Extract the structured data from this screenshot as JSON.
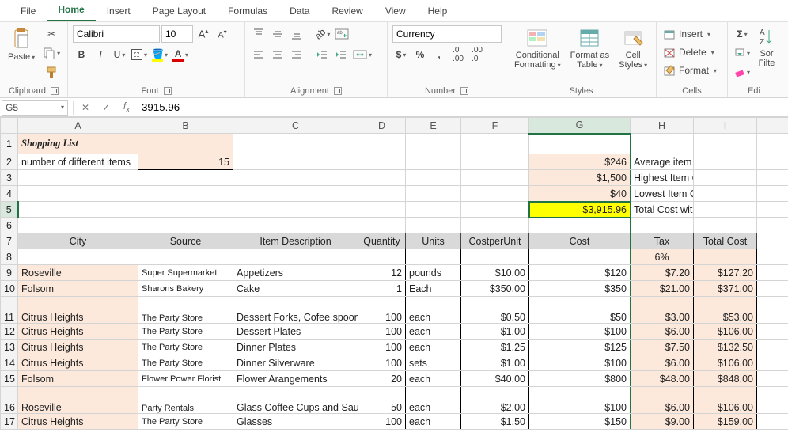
{
  "tabs": [
    "File",
    "Home",
    "Insert",
    "Page Layout",
    "Formulas",
    "Data",
    "Review",
    "View",
    "Help"
  ],
  "active_tab": "Home",
  "ribbon": {
    "clipboard": {
      "paste": "Paste",
      "title": "Clipboard"
    },
    "font": {
      "name": "Calibri",
      "size": "10",
      "title": "Font"
    },
    "alignment": {
      "title": "Alignment"
    },
    "number": {
      "format": "Currency",
      "title": "Number"
    },
    "styles": {
      "cond": "Conditional\nFormatting",
      "fmttbl": "Format as\nTable",
      "cellst": "Cell\nStyles",
      "title": "Styles"
    },
    "cells": {
      "insert": "Insert",
      "delete": "Delete",
      "format": "Format",
      "title": "Cells"
    },
    "editing": {
      "sort": "Sor",
      "filter": "Filte",
      "title": "Edi"
    }
  },
  "namebox": "G5",
  "formula": "3915.96",
  "columns": [
    "A",
    "B",
    "C",
    "D",
    "E",
    "F",
    "G",
    "H",
    "I"
  ],
  "sheet": {
    "title": "Shopping List",
    "r2": {
      "label": "number of different items",
      "value": "15"
    },
    "stats": [
      {
        "val": "$246",
        "lbl": "Average item cost"
      },
      {
        "val": "$1,500",
        "lbl": "Highest Item Cost"
      },
      {
        "val": "$40",
        "lbl": "Lowest Item Cost"
      },
      {
        "val": "$3,915.96",
        "lbl": "Total Cost with Tax"
      }
    ],
    "headers": [
      "City",
      "Source",
      "Item Description",
      "Quantity",
      "Units",
      "CostperUnit",
      "Cost",
      "Tax",
      "Total Cost"
    ],
    "taxrate": "6%",
    "rows": [
      {
        "city": "Roseville",
        "src": "Super Supermarket",
        "desc": "Appetizers",
        "qty": "12",
        "unit": "pounds",
        "cpu": "$10.00",
        "cost": "$120",
        "tax": "$7.20",
        "tot": "$127.20"
      },
      {
        "city": "Folsom",
        "src": "Sharons Bakery",
        "desc": "Cake",
        "qty": "1",
        "unit": "Each",
        "cpu": "$350.00",
        "cost": "$350",
        "tax": "$21.00",
        "tot": "$371.00"
      },
      {
        "city": "Citrus Heights",
        "src": "The Party Store",
        "desc": "Dessert Forks, Cofee spoons",
        "qty": "100",
        "unit": "each",
        "cpu": "$0.50",
        "cost": "$50",
        "tax": "$3.00",
        "tot": "$53.00",
        "tall": true
      },
      {
        "city": "Citrus Heights",
        "src": "The Party Store",
        "desc": "Dessert Plates",
        "qty": "100",
        "unit": "each",
        "cpu": "$1.00",
        "cost": "$100",
        "tax": "$6.00",
        "tot": "$106.00"
      },
      {
        "city": "Citrus Heights",
        "src": "The Party Store",
        "desc": "Dinner Plates",
        "qty": "100",
        "unit": "each",
        "cpu": "$1.25",
        "cost": "$125",
        "tax": "$7.50",
        "tot": "$132.50"
      },
      {
        "city": "Citrus Heights",
        "src": "The Party Store",
        "desc": "Dinner Silverware",
        "qty": "100",
        "unit": "sets",
        "cpu": "$1.00",
        "cost": "$100",
        "tax": "$6.00",
        "tot": "$106.00"
      },
      {
        "city": "Folsom",
        "src": "Flower Power Florist",
        "desc": "Flower Arangements",
        "qty": "20",
        "unit": "each",
        "cpu": "$40.00",
        "cost": "$800",
        "tax": "$48.00",
        "tot": "$848.00"
      },
      {
        "city": "Roseville",
        "src": "Party Rentals",
        "desc": "Glass Coffee Cups and Saucers",
        "qty": "50",
        "unit": "each",
        "cpu": "$2.00",
        "cost": "$100",
        "tax": "$6.00",
        "tot": "$106.00",
        "tall": true
      },
      {
        "city": "Citrus Heights",
        "src": "The Party Store",
        "desc": "Glasses",
        "qty": "100",
        "unit": "each",
        "cpu": "$1.50",
        "cost": "$150",
        "tax": "$9.00",
        "tot": "$159.00"
      }
    ]
  }
}
